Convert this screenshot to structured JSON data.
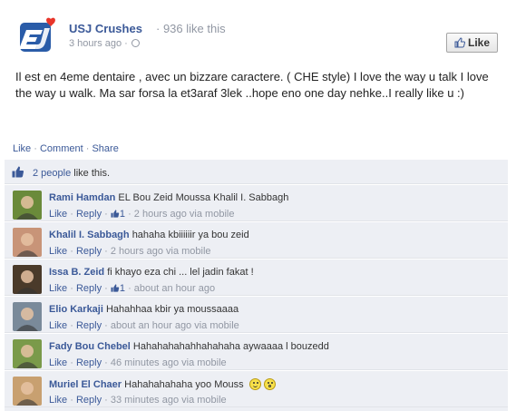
{
  "post": {
    "page_name": "USJ Crushes",
    "like_count": "· 936 like this",
    "timestamp": "3 hours ago ·",
    "like_button": "Like",
    "text": "Il est en 4eme dentaire , avec un bizzare caractere. ( CHE style) I love the way u talk I love the way u walk. Ma sar forsa la et3araf 3lek ..hope eno one day nehke..I really like u :)",
    "actions": {
      "like": "Like",
      "comment": "Comment",
      "share": "Share",
      "separator": "·"
    }
  },
  "likes": {
    "people": "2 people",
    "suffix": "like this."
  },
  "comments": [
    {
      "name": "Rami Hamdan",
      "text": "EL Bou Zeid Moussa Khalil I. Sabbagh",
      "like": "Like",
      "reply": "Reply",
      "likes": "1",
      "time": "· 2 hours ago via mobile",
      "avatar_color": "#6a8a3a"
    },
    {
      "name": "Khalil I. Sabbagh",
      "text": "hahaha kbiiiiiir ya bou zeid",
      "like": "Like",
      "reply": "Reply",
      "time": "· 2 hours ago via mobile",
      "avatar_color": "#c89478"
    },
    {
      "name": "Issa B. Zeid",
      "text": "fi khayo eza chi ... lel jadin fakat !",
      "like": "Like",
      "reply": "Reply",
      "likes": "1",
      "time": "· about an hour ago",
      "avatar_color": "#4a3a2a"
    },
    {
      "name": "Elio Karkaji",
      "text": "Hahahhaa kbir ya moussaaaa",
      "like": "Like",
      "reply": "Reply",
      "time": "· about an hour ago via mobile",
      "avatar_color": "#7a8a9a"
    },
    {
      "name": "Fady Bou Chebel",
      "text": "Hahahahahahhahahaha aywaaaa l bouzedd",
      "like": "Like",
      "reply": "Reply",
      "time": "· 46 minutes ago via mobile",
      "avatar_color": "#7a9a4a"
    },
    {
      "name": "Muriel El Chaer",
      "text": "Hahahahahaha yoo Mouss",
      "like": "Like",
      "reply": "Reply",
      "time": "· 33 minutes ago via mobile",
      "avatar_color": "#c8a070"
    }
  ],
  "icons": [
    "usj-logo",
    "globe-icon",
    "thumbs-up-icon",
    "smile-emoticon",
    "surprised-emoticon"
  ],
  "colors": {
    "link": "#3b5998",
    "meta": "#9197a3",
    "ufi_bg": "#edeff4",
    "logo_red": "#e8352a"
  }
}
